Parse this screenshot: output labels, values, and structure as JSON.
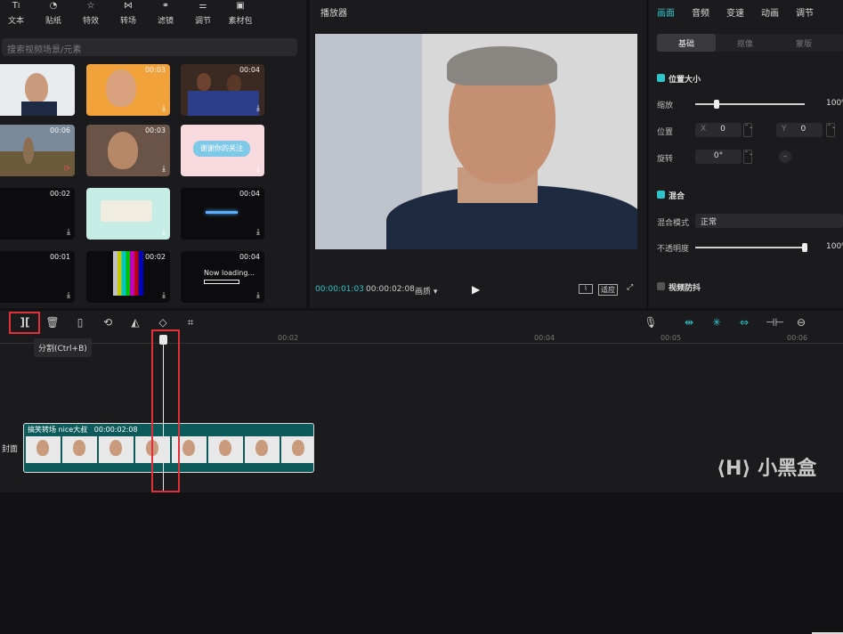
{
  "toolbar": {
    "items": [
      {
        "label": "文本",
        "icon": "text-icon"
      },
      {
        "label": "贴纸",
        "icon": "sticker-icon"
      },
      {
        "label": "特效",
        "icon": "effects-icon"
      },
      {
        "label": "转场",
        "icon": "transition-icon"
      },
      {
        "label": "滤镜",
        "icon": "filter-icon"
      },
      {
        "label": "调节",
        "icon": "adjust-icon"
      },
      {
        "label": "素材包",
        "icon": "package-icon"
      }
    ]
  },
  "search": {
    "placeholder": "搜索视频场景/元素"
  },
  "media": [
    {
      "dur": "",
      "dl": ""
    },
    {
      "dur": "00:03",
      "dl": "⤓"
    },
    {
      "dur": "00:04",
      "dl": "⤓"
    },
    {
      "dur": "00:06",
      "dl": "⟳"
    },
    {
      "dur": "00:03",
      "dl": "⤓"
    },
    {
      "dur": "",
      "dl": "⤓",
      "text": "谢谢你的关注"
    },
    {
      "dur": "00:02",
      "dl": "⤓"
    },
    {
      "dur": "",
      "dl": "⤓"
    },
    {
      "dur": "00:04",
      "dl": "⤓"
    },
    {
      "dur": "00:01",
      "dl": "⤓"
    },
    {
      "dur": "00:02",
      "dl": "⤓"
    },
    {
      "dur": "00:04",
      "dl": "⤓",
      "text": "Now loading..."
    }
  ],
  "player": {
    "title": "播放器",
    "current_time": "00:00:01:03",
    "total_time": "00:00:02:08",
    "quality": "画质",
    "fit": "适应"
  },
  "right": {
    "tabs": [
      "画面",
      "音频",
      "变速",
      "动画",
      "调节"
    ],
    "subtabs": [
      "基础",
      "抠像",
      "蒙版"
    ],
    "pos_size": "位置大小",
    "scale_label": "缩放",
    "scale_value": "100%",
    "position_label": "位置",
    "x_label": "X",
    "x_value": "0",
    "y_label": "Y",
    "y_value": "0",
    "rotate_label": "旋转",
    "rotate_value": "0°",
    "blend": "混合",
    "blend_mode_label": "混合模式",
    "blend_mode_value": "正常",
    "opacity_label": "不透明度",
    "opacity_value": "100%",
    "stabilize": "视频防抖"
  },
  "timeline": {
    "tooltip": "分割(Ctrl+B)",
    "ticks": [
      "00:02",
      "00:04",
      "00:05",
      "00:06"
    ],
    "cover_label": "封面",
    "clip_name": "搞笑转场 nice大叔",
    "clip_dur": "00:00:02:08"
  },
  "watermark": "小黑盒",
  "colors": {
    "accent": "#2ec4cc",
    "highlight": "#e0303a"
  }
}
